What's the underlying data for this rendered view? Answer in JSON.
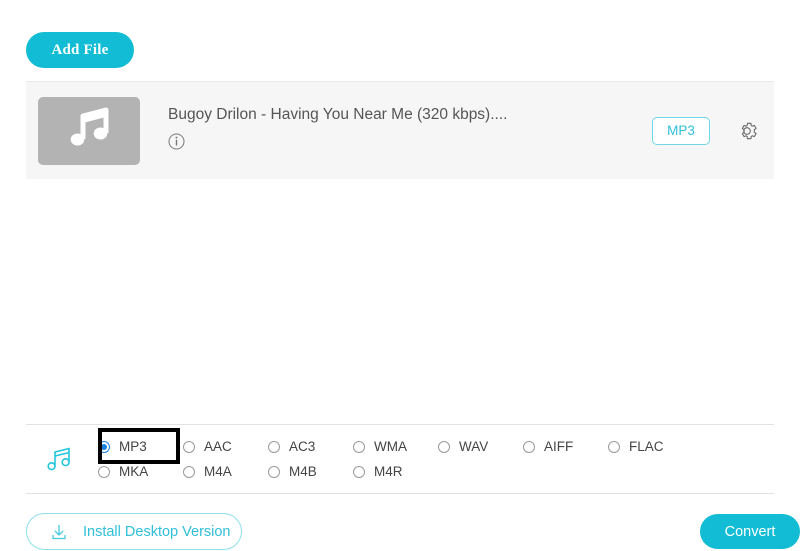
{
  "toolbar": {
    "add_file_label": "Add File"
  },
  "file_row": {
    "thumbnail_icon": "music-note-icon",
    "title": "Bugoy Drilon - Having You Near Me (320 kbps)....",
    "info_icon": "info-icon",
    "format_badge": "MP3",
    "settings_icon": "gear-icon"
  },
  "format_section": {
    "section_icon": "music-note-icon",
    "selected": "MP3",
    "options": [
      {
        "label": "MP3",
        "selected": true
      },
      {
        "label": "AAC",
        "selected": false
      },
      {
        "label": "AC3",
        "selected": false
      },
      {
        "label": "WMA",
        "selected": false
      },
      {
        "label": "WAV",
        "selected": false
      },
      {
        "label": "AIFF",
        "selected": false
      },
      {
        "label": "FLAC",
        "selected": false
      },
      {
        "label": "MKA",
        "selected": false
      },
      {
        "label": "M4A",
        "selected": false
      },
      {
        "label": "M4B",
        "selected": false
      },
      {
        "label": "M4R",
        "selected": false
      }
    ]
  },
  "footer": {
    "install_label": "Install Desktop Version",
    "install_icon": "download-icon",
    "convert_label": "Convert"
  },
  "colors": {
    "accent": "#12bcd4",
    "accent_text": "#2fbfd8",
    "radio_selected": "#1782e0",
    "row_background": "#f6f6f6",
    "thumbnail": "#b3b3b3",
    "highlight": "#000000"
  }
}
